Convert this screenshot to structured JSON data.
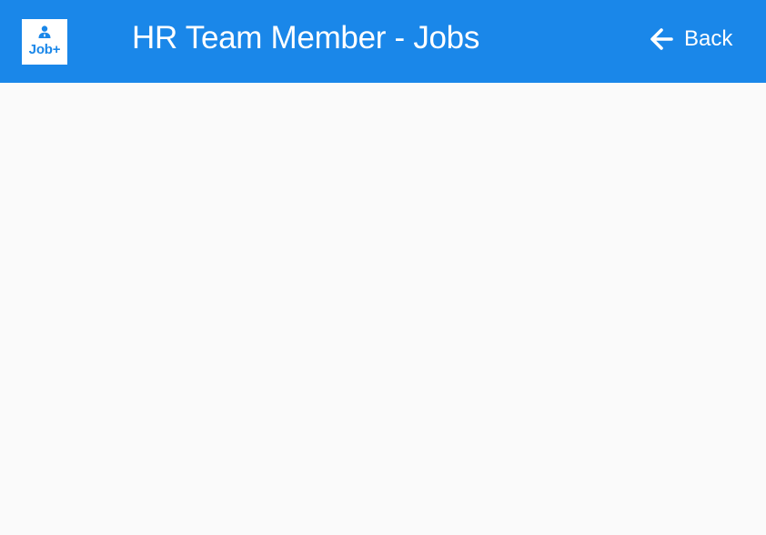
{
  "header": {
    "logo_text": "Job+",
    "logo_icon": "person-icon",
    "title": "HR Team Member - Jobs",
    "back_label": "Back",
    "back_icon": "arrow-left-icon"
  },
  "colors": {
    "primary": "#1a87e9",
    "background": "#fafafa",
    "on_primary": "#ffffff"
  }
}
